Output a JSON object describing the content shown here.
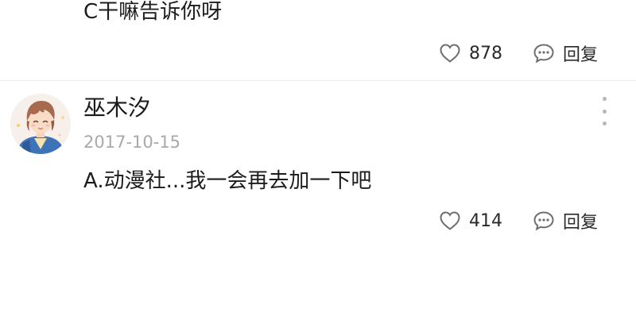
{
  "previous_comment": {
    "text": "C干嘛告诉你呀",
    "like_count": "878",
    "reply_label": "回复"
  },
  "comment": {
    "username": "巫木汐",
    "date": "2017-10-15",
    "text": "A.动漫社...我一会再去加一下吧",
    "like_count": "414",
    "reply_label": "回复",
    "avatar_icon": "anime-avatar"
  },
  "icons": {
    "like": "heart-outline-icon",
    "reply": "speech-bubble-icon",
    "more": "vertical-ellipsis-icon"
  },
  "colors": {
    "text": "#1c1c1c",
    "secondary": "#a9a9a9",
    "icon": "#6e6e6e",
    "divider": "#ececec"
  }
}
